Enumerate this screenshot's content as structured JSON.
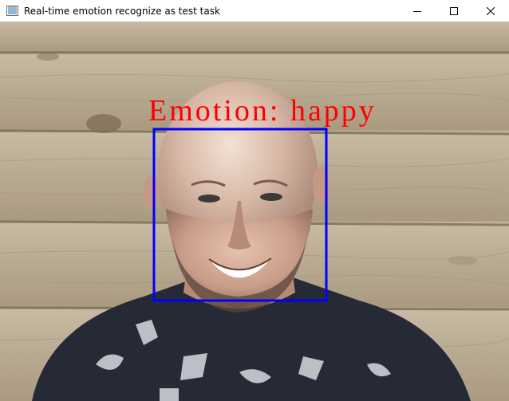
{
  "window": {
    "title": "Real-time emotion recognize as test task",
    "icons": {
      "app": "window-app-icon",
      "minimize": "minimize-icon",
      "maximize": "maximize-icon",
      "close": "close-icon"
    }
  },
  "frame": {
    "overlay_label": "Emotion: happy",
    "overlay_color": "#ff0000",
    "face_box_color": "#0000ff",
    "background_color": "#b9ab93"
  }
}
